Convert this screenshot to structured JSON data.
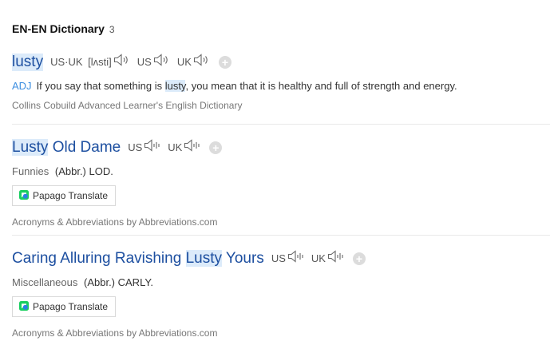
{
  "header": {
    "title": "EN-EN Dictionary",
    "count": "3"
  },
  "entries": [
    {
      "word": "lusty",
      "pron_label": "US·UK",
      "phonetic": "[lʌsti]",
      "us_label": "US",
      "uk_label": "UK",
      "pos": "ADJ",
      "def_before": "If you say that something is ",
      "def_highlight": "lusty",
      "def_after": ", you mean that it is healthy and full of strength and energy.",
      "source": "Collins Cobuild Advanced Learner's English Dictionary"
    },
    {
      "word_highlight": "Lusty",
      "word_rest": " Old Dame",
      "us_label": "US",
      "uk_label": "UK",
      "category": "Funnies",
      "abbr": "(Abbr.) LOD.",
      "translate_label": "Papago Translate",
      "source": "Acronyms & Abbreviations by Abbreviations.com"
    },
    {
      "word_before": "Caring Alluring Ravishing ",
      "word_highlight": "Lusty",
      "word_after": " Yours",
      "us_label": "US",
      "uk_label": "UK",
      "category": "Miscellaneous",
      "abbr": "(Abbr.) CARLY.",
      "translate_label": "Papago Translate",
      "source": "Acronyms & Abbreviations by Abbreviations.com"
    }
  ],
  "icons": {
    "speaker": "speaker-icon",
    "speaker_lines": "speaker-lines-icon",
    "add": "plus-icon",
    "papago": "papago-logo-icon"
  }
}
